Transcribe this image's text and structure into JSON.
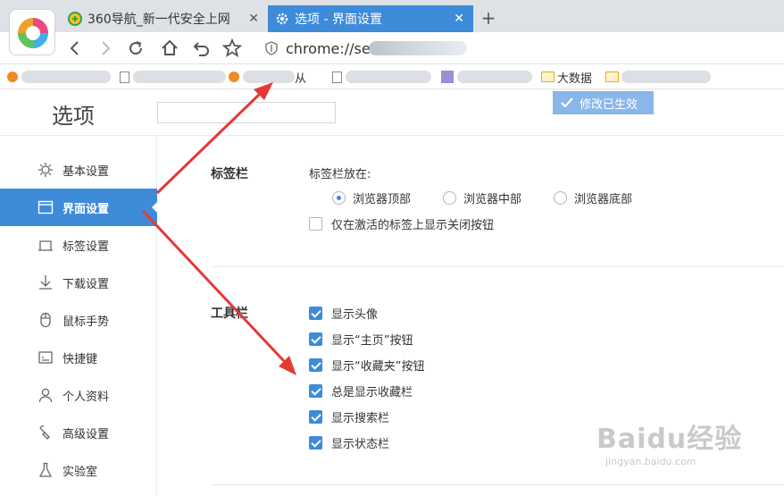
{
  "browser": {
    "tabs": [
      {
        "label": "360导航_新一代安全上网",
        "close": "✕",
        "icon": "360-icon"
      },
      {
        "label": "选项 - 界面设置",
        "close": "✕",
        "icon": "gear-icon"
      }
    ],
    "new_tab": "+",
    "address": "chrome://se",
    "bookmarks": [
      {
        "label": "",
        "type": "blurred"
      },
      {
        "label": "",
        "type": "blurred"
      },
      {
        "label": "从",
        "type": "blurred"
      },
      {
        "label": "",
        "type": "blurred"
      },
      {
        "label": "",
        "type": "blurred"
      },
      {
        "label": "大数据",
        "type": "folder"
      },
      {
        "label": "",
        "type": "folder"
      }
    ]
  },
  "header": {
    "title": "选项",
    "search_placeholder": "",
    "toast": "修改已生效"
  },
  "sidebar": {
    "items": [
      {
        "label": "基本设置",
        "icon": "sun-icon",
        "active": false
      },
      {
        "label": "界面设置",
        "icon": "window-icon",
        "active": true
      },
      {
        "label": "标签设置",
        "icon": "tab-icon",
        "active": false
      },
      {
        "label": "下载设置",
        "icon": "download-icon",
        "active": false
      },
      {
        "label": "鼠标手势",
        "icon": "mouse-icon",
        "active": false
      },
      {
        "label": "快捷键",
        "icon": "keyboard-icon",
        "active": false
      },
      {
        "label": "个人资料",
        "icon": "person-icon",
        "active": false
      },
      {
        "label": "高级设置",
        "icon": "wrench-icon",
        "active": false
      },
      {
        "label": "实验室",
        "icon": "flask-icon",
        "active": false
      }
    ]
  },
  "tabbar_section": {
    "title": "标签栏",
    "position_label": "标签栏放在:",
    "positions": [
      {
        "label": "浏览器顶部",
        "selected": true
      },
      {
        "label": "浏览器中部",
        "selected": false
      },
      {
        "label": "浏览器底部",
        "selected": false
      }
    ],
    "close_only_active": {
      "label": "仅在激活的标签上显示关闭按钮",
      "checked": false
    }
  },
  "toolbar_section": {
    "title": "工具栏",
    "options": [
      {
        "label": "显示头像",
        "checked": true
      },
      {
        "label": "显示“主页”按钮",
        "checked": true
      },
      {
        "label": "显示“收藏夹”按钮",
        "checked": true
      },
      {
        "label": "总是显示收藏栏",
        "checked": true
      },
      {
        "label": "显示搜索栏",
        "checked": true
      },
      {
        "label": "显示状态栏",
        "checked": true
      }
    ]
  },
  "watermark": {
    "brand": "Baidu经验",
    "url": "jingyan.baidu.com"
  },
  "colors": {
    "accent": "#3d8bd9",
    "annotation": "#e53935",
    "toast": "#8ab7e9"
  }
}
